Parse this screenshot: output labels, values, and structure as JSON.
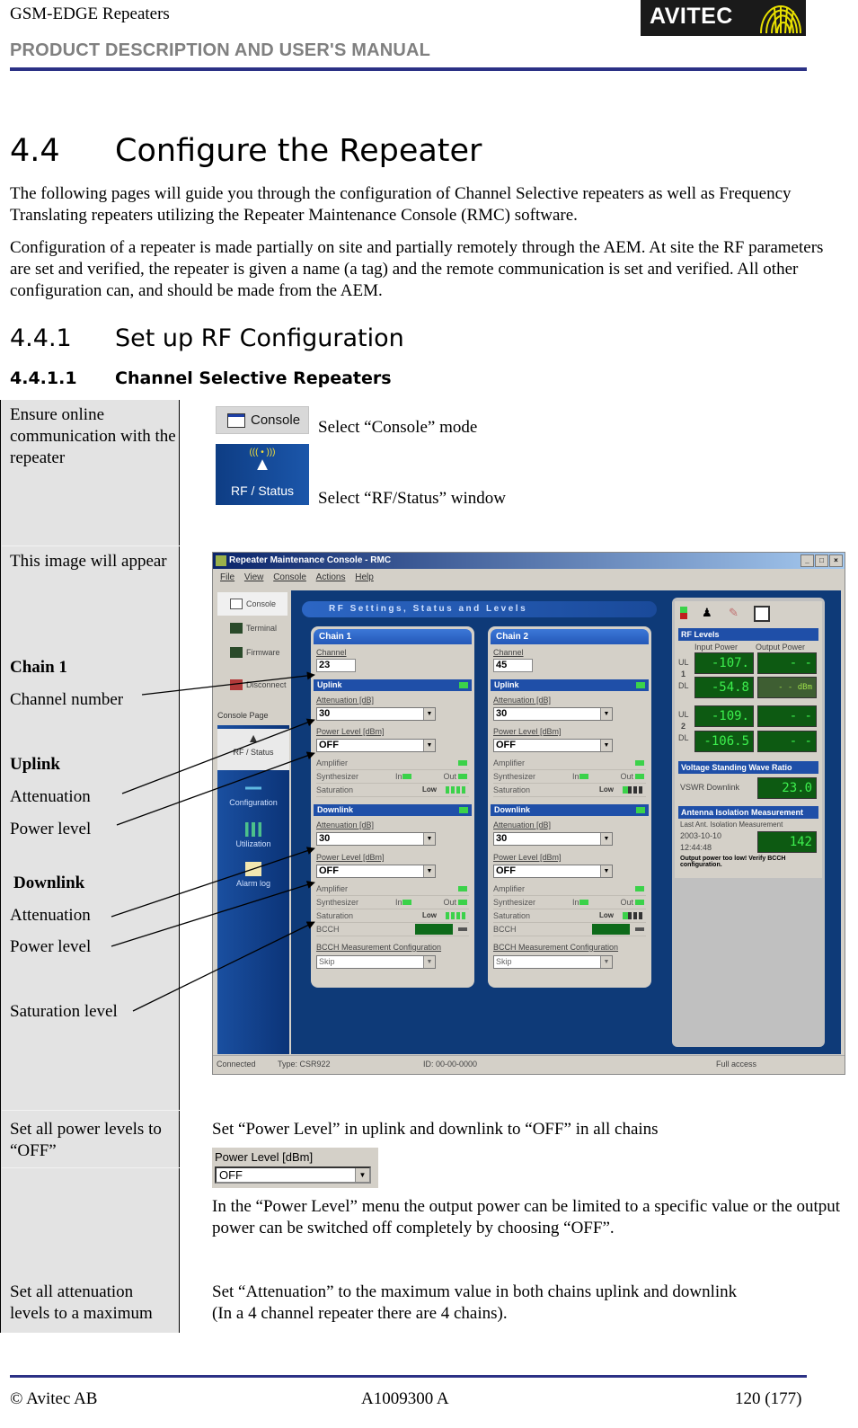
{
  "header": {
    "doc_title": "GSM-EDGE Repeaters",
    "doc_subtitle": "PRODUCT DESCRIPTION AND USER'S MANUAL",
    "logo_text": "AVITEC"
  },
  "section": {
    "number": "4.4",
    "title": "Configure the Repeater",
    "paragraphs": [
      "The following pages will guide you through the configuration of Channel Selective repeaters as well as Frequency Translating repeaters utilizing the Repeater Maintenance Console (RMC) software.",
      "Configuration of a repeater is made partially on site and partially remotely through the AEM. At site the RF parameters are set and verified, the repeater is given a name (a tag) and the remote communication is set and verified. All other configuration can, and should be made from the AEM."
    ]
  },
  "subsection": {
    "number": "4.4.1",
    "title": "Set up RF Configuration"
  },
  "subsubsection": {
    "number": "4.4.1.1",
    "title": "Channel Selective Repeaters"
  },
  "table": {
    "row1": {
      "left": "Ensure online communication with the repeater",
      "console_button": "Console",
      "console_instruction": "Select “Console” mode",
      "rf_button": "RF / Status",
      "rf_instruction": "Select “RF/Status” window"
    },
    "row2": {
      "left_intro": "This image will appear",
      "labels": {
        "chain1": "Chain 1",
        "channel_number": "Channel number",
        "uplink": "Uplink",
        "ul_attenuation": "Attenuation",
        "ul_power_level": "Power level",
        "downlink": "Downlink",
        "dl_attenuation": "Attenuation",
        "dl_power_level": "Power level",
        "saturation_level": "Saturation level"
      }
    },
    "row3": {
      "left": "Set all power levels to “OFF”",
      "instruction": "Set “Power Level” in uplink and downlink to “OFF” in all chains",
      "widget_label": "Power Level [dBm]",
      "widget_value": "OFF",
      "note": "In the “Power Level” menu the output power can be limited to a specific value or the output power can be switched off completely by choosing “OFF”."
    },
    "row4": {
      "left": "Set all attenuation levels to a maximum",
      "instruction_line1": "Set “Attenuation” to the maximum value in both chains uplink and downlink",
      "instruction_line2": "(In a 4 channel repeater there are 4 chains)."
    }
  },
  "rmc": {
    "window_title": "Repeater Maintenance Console - RMC",
    "menu": [
      "File",
      "View",
      "Console",
      "Actions",
      "Help"
    ],
    "nav_top": [
      "Console",
      "Terminal",
      "Firmware",
      "Disconnect"
    ],
    "console_page_label": "Console Page",
    "nav_pages": [
      "RF / Status",
      "Configuration",
      "Utilization",
      "Alarm log"
    ],
    "banner": "RF Settings, Status and Levels",
    "field_labels": {
      "channel": "Channel",
      "uplink": "Uplink",
      "downlink": "Downlink",
      "attenuation": "Attenuation [dB]",
      "power_level": "Power Level [dBm]",
      "amplifier": "Amplifier",
      "synthesizer": "Synthesizer",
      "synth_in": "In",
      "synth_out": "Out",
      "saturation": "Saturation",
      "saturation_value": "Low",
      "bcch": "BCCH",
      "bcch_config": "BCCH Measurement Configuration",
      "bcch_config_value": "Skip"
    },
    "chains": [
      {
        "name": "Chain 1",
        "channel": "23",
        "ul_attenuation": "30",
        "ul_power": "OFF",
        "dl_attenuation": "30",
        "dl_power": "OFF"
      },
      {
        "name": "Chain 2",
        "channel": "45",
        "ul_attenuation": "30",
        "ul_power": "OFF",
        "dl_attenuation": "30",
        "dl_power": "OFF"
      }
    ],
    "rf_levels": {
      "title": "RF Levels",
      "input_power": "Input Power",
      "output_power": "Output Power",
      "ul": "UL",
      "dl": "DL",
      "chain1_label": "1",
      "chain2_label": "2",
      "c1_ul_in": "-107.",
      "c1_ul_out": "- -",
      "c1_dl_in": "-54.8",
      "c1_dl_out": "- -  dBm",
      "c2_ul_in": "-109.",
      "c2_ul_out": "- -",
      "c2_dl_in": "-106.5",
      "c2_dl_out": "- -"
    },
    "vswr": {
      "title": "Voltage Standing Wave Ratio",
      "label": "VSWR Downlink",
      "value": "23.0"
    },
    "isolation": {
      "title": "Antenna Isolation Measurement",
      "label": "Last Ant. Isolation Measurement",
      "date": "2003-10-10",
      "time": "12:44:48",
      "value": "142",
      "warning": "Output power too low! Verify BCCH configuration."
    },
    "statusbar": {
      "connection": "Connected",
      "type": "Type: CSR922",
      "id": "ID: 00-00-0000",
      "access": "Full access"
    }
  },
  "footer": {
    "copyright": "© Avitec AB",
    "doc_number": "A1009300 A",
    "page": "120 (177)"
  }
}
